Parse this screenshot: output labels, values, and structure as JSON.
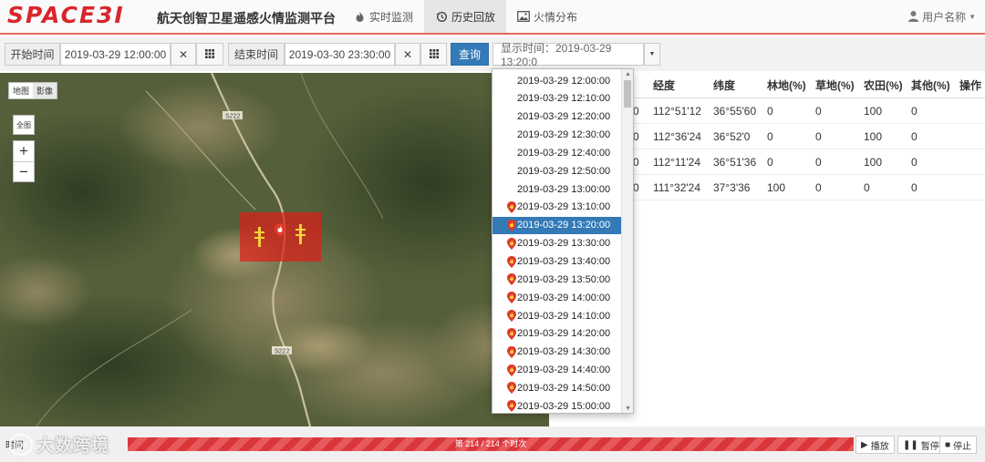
{
  "header": {
    "logo": "SPACE3I",
    "title": "航天创智卫星遥感火情监测平台",
    "nav": [
      {
        "label": "实时监测",
        "icon": "fire-icon"
      },
      {
        "label": "历史回放",
        "icon": "history-icon"
      },
      {
        "label": "火情分布",
        "icon": "image-icon"
      }
    ],
    "user": "用户名称"
  },
  "toolbar": {
    "start_label": "开始时间",
    "start_value": "2019-03-29 12:00:00",
    "end_label": "结束时间",
    "end_value": "2019-03-30 23:30:00",
    "query_label": "查询",
    "display_label": "显示时间：2019-03-29 13:20:0"
  },
  "map": {
    "toggle": [
      "地图",
      "影像"
    ],
    "full_label": "全图",
    "zoom_in": "+",
    "zoom_out": "−",
    "road_labels": [
      "S222",
      "S222"
    ]
  },
  "table": {
    "headers": [
      "经度",
      "纬度",
      "林地(%)",
      "草地(%)",
      "农田(%)",
      "其他(%)",
      "操作"
    ],
    "rows": [
      {
        "lead": "0",
        "lon": "112°51'12",
        "lat": "36°55'60",
        "forest": "0",
        "grass": "0",
        "farm": "100",
        "other": "0"
      },
      {
        "lead": "0",
        "lon": "112°36'24",
        "lat": "36°52'0",
        "forest": "0",
        "grass": "0",
        "farm": "100",
        "other": "0"
      },
      {
        "lead": "0",
        "lon": "112°11'24",
        "lat": "36°51'36",
        "forest": "0",
        "grass": "0",
        "farm": "100",
        "other": "0"
      },
      {
        "lead": "0",
        "lon": "111°32'24",
        "lat": "37°3'36",
        "forest": "100",
        "grass": "0",
        "farm": "0",
        "other": "0"
      }
    ]
  },
  "dropdown": {
    "items": [
      {
        "time": "2019-03-29 12:00:00",
        "fire": false
      },
      {
        "time": "2019-03-29 12:10:00",
        "fire": false
      },
      {
        "time": "2019-03-29 12:20:00",
        "fire": false
      },
      {
        "time": "2019-03-29 12:30:00",
        "fire": false
      },
      {
        "time": "2019-03-29 12:40:00",
        "fire": false
      },
      {
        "time": "2019-03-29 12:50:00",
        "fire": false
      },
      {
        "time": "2019-03-29 13:00:00",
        "fire": false
      },
      {
        "time": "2019-03-29 13:10:00",
        "fire": true
      },
      {
        "time": "2019-03-29 13:20:00",
        "fire": true,
        "selected": true
      },
      {
        "time": "2019-03-29 13:30:00",
        "fire": true
      },
      {
        "time": "2019-03-29 13:40:00",
        "fire": true
      },
      {
        "time": "2019-03-29 13:50:00",
        "fire": true
      },
      {
        "time": "2019-03-29 14:00:00",
        "fire": true
      },
      {
        "time": "2019-03-29 14:10:00",
        "fire": true
      },
      {
        "time": "2019-03-29 14:20:00",
        "fire": true
      },
      {
        "time": "2019-03-29 14:30:00",
        "fire": true
      },
      {
        "time": "2019-03-29 14:40:00",
        "fire": true
      },
      {
        "time": "2019-03-29 14:50:00",
        "fire": true
      },
      {
        "time": "2019-03-29 15:00:00",
        "fire": true
      }
    ]
  },
  "playback": {
    "label": "时间",
    "progress_text": "第 214 / 214 个时次",
    "progress_fraction": 1.0,
    "play_label": "播放",
    "pause_label": "暂停",
    "stop_label": "停止"
  },
  "watermark": {
    "logo": "jpo",
    "text": "大数跨境"
  },
  "colors": {
    "brand": "#d8262b",
    "primary": "#337ab7",
    "fire": "#dc1e19",
    "progress": "#d9363a"
  }
}
